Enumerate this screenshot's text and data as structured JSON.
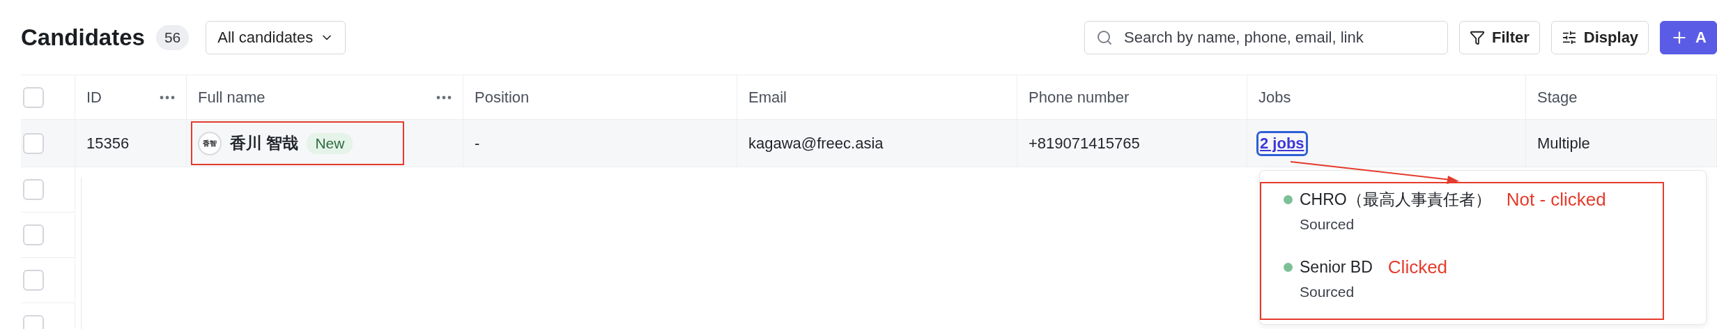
{
  "header": {
    "title": "Candidates",
    "count": "56",
    "view_select": {
      "value": "All candidates"
    },
    "search": {
      "placeholder": "Search by name, phone, email, link"
    },
    "buttons": [
      {
        "label": "Filter",
        "kind": "filter"
      },
      {
        "label": "Display",
        "kind": "display"
      },
      {
        "label": "A",
        "kind": "add"
      }
    ]
  },
  "table": {
    "header_checkbox": {
      "checked": false
    },
    "columns": [
      {
        "label": "ID",
        "menu": true
      },
      {
        "label": "Full name",
        "menu": true
      },
      {
        "label": "Position",
        "menu": false
      },
      {
        "label": "Email",
        "menu": false
      },
      {
        "label": "Phone number",
        "menu": false
      },
      {
        "label": "Jobs",
        "menu": false
      },
      {
        "label": "Stage",
        "menu": false
      }
    ],
    "rows": [
      {
        "checked": false,
        "id": "15356",
        "avatar": "香智",
        "name": "香川 智哉",
        "badge": "New",
        "position": "-",
        "email": "kagawa@freec.asia",
        "phone": "+819071415765",
        "jobs": "2 jobs",
        "jobs_focused": true,
        "stage": "Multiple"
      },
      {
        "checked": false
      },
      {
        "checked": false
      },
      {
        "checked": false
      },
      {
        "checked": false
      }
    ]
  },
  "jobs_popup": {
    "items": [
      {
        "title": "CHRO（最高人事責任者）",
        "stage": "Sourced",
        "color": "#7dbf96",
        "annotation": "Not - clicked"
      },
      {
        "title": "Senior BD",
        "stage": "Sourced",
        "color": "#7dbf96",
        "annotation": "Clicked"
      }
    ]
  }
}
